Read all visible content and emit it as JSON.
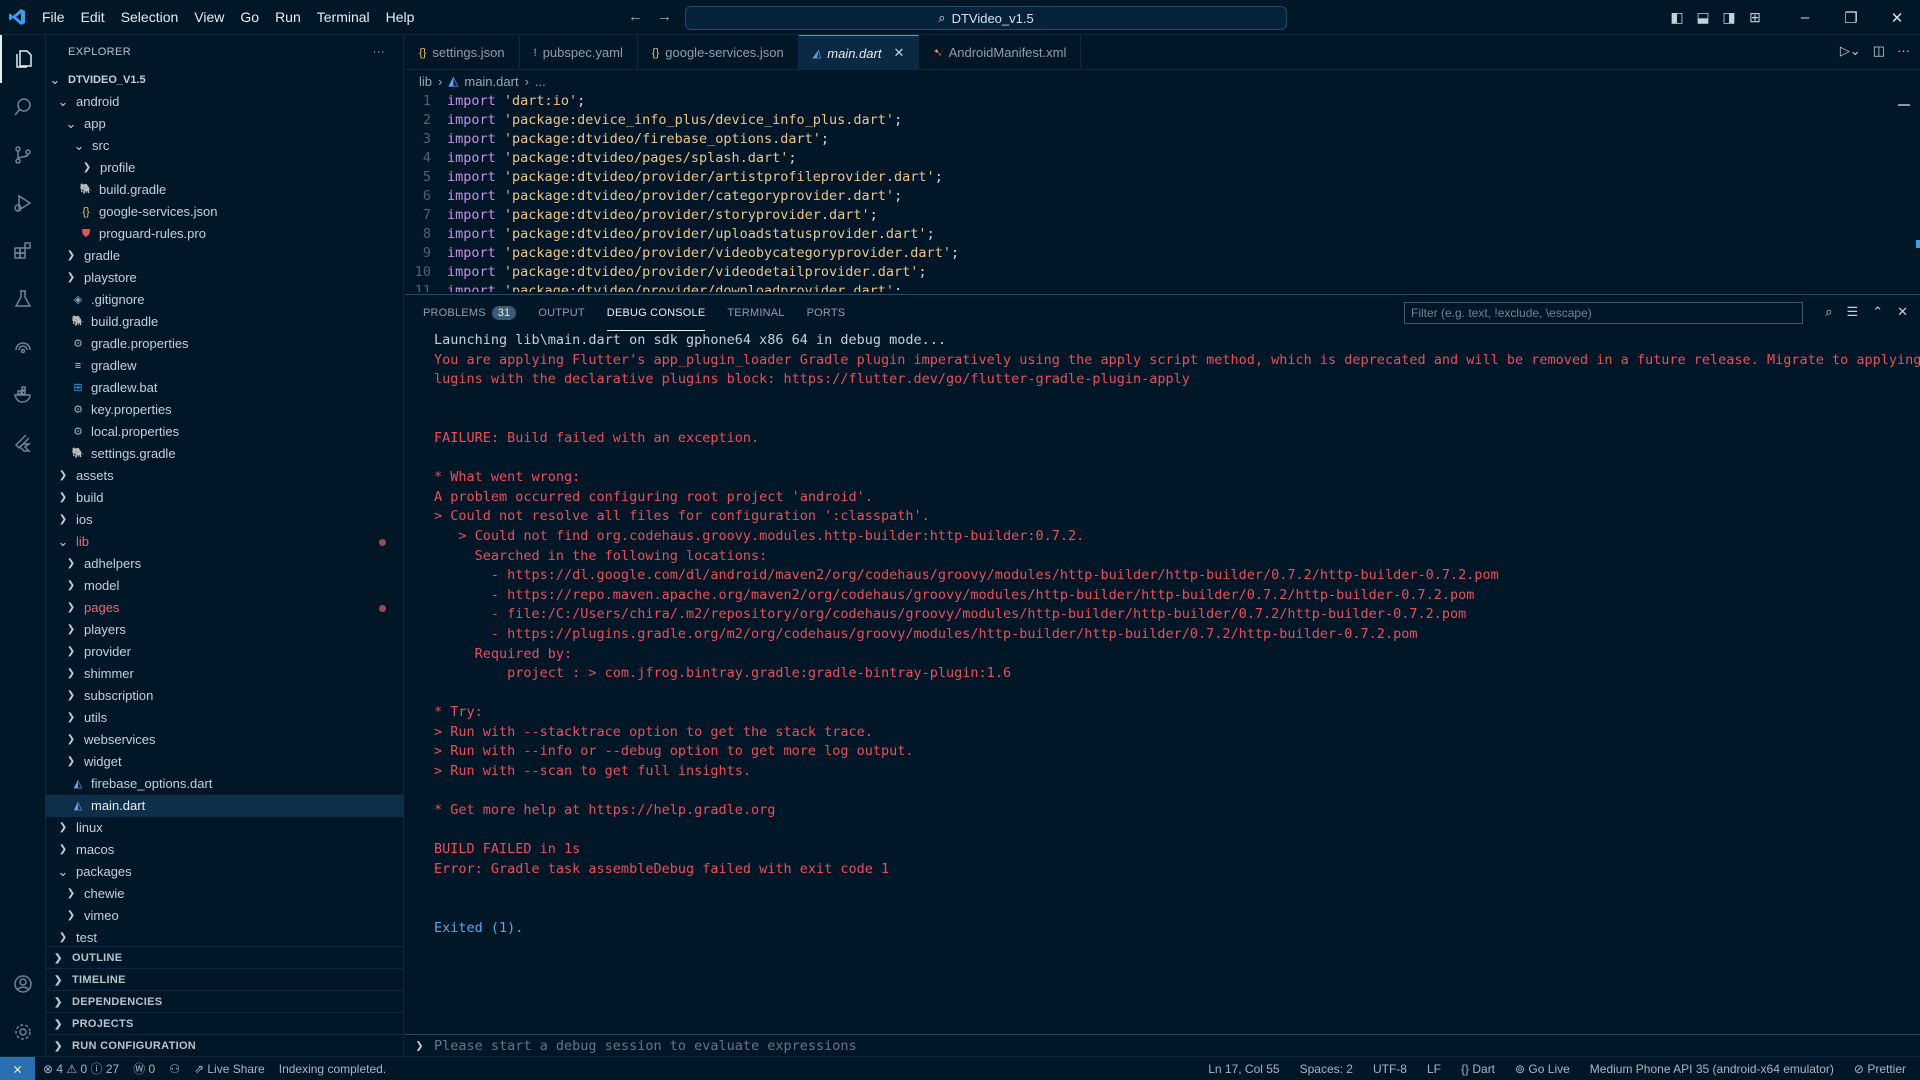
{
  "titlebar": {
    "menus": [
      "File",
      "Edit",
      "Selection",
      "View",
      "Go",
      "Run",
      "Terminal",
      "Help"
    ],
    "search_text": "DTVideo_v1.5"
  },
  "sidebar": {
    "title": "EXPLORER",
    "tree": [
      {
        "label": "DTVIDEO_V1.5",
        "depth": 0,
        "chev": "down",
        "bold": true
      },
      {
        "label": "android",
        "depth": 1,
        "chev": "down"
      },
      {
        "label": "app",
        "depth": 2,
        "chev": "down"
      },
      {
        "label": "src",
        "depth": 3,
        "chev": "down"
      },
      {
        "label": "profile",
        "depth": 4,
        "chev": "right"
      },
      {
        "label": "build.gradle",
        "depth": 3,
        "icon": "gradle"
      },
      {
        "label": "google-services.json",
        "depth": 3,
        "icon": "json"
      },
      {
        "label": "proguard-rules.pro",
        "depth": 3,
        "icon": "pro"
      },
      {
        "label": "gradle",
        "depth": 2,
        "chev": "right"
      },
      {
        "label": "playstore",
        "depth": 2,
        "chev": "right"
      },
      {
        "label": ".gitignore",
        "depth": 2,
        "icon": "git"
      },
      {
        "label": "build.gradle",
        "depth": 2,
        "icon": "gradle"
      },
      {
        "label": "gradle.properties",
        "depth": 2,
        "icon": "gear"
      },
      {
        "label": "gradlew",
        "depth": 2,
        "icon": "lines"
      },
      {
        "label": "gradlew.bat",
        "depth": 2,
        "icon": "win"
      },
      {
        "label": "key.properties",
        "depth": 2,
        "icon": "gear"
      },
      {
        "label": "local.properties",
        "depth": 2,
        "icon": "gear"
      },
      {
        "label": "settings.gradle",
        "depth": 2,
        "icon": "gradle"
      },
      {
        "label": "assets",
        "depth": 1,
        "chev": "right"
      },
      {
        "label": "build",
        "depth": 1,
        "chev": "right"
      },
      {
        "label": "ios",
        "depth": 1,
        "chev": "right"
      },
      {
        "label": "lib",
        "depth": 1,
        "chev": "down",
        "red": true,
        "dot": true
      },
      {
        "label": "adhelpers",
        "depth": 2,
        "chev": "right"
      },
      {
        "label": "model",
        "depth": 2,
        "chev": "right"
      },
      {
        "label": "pages",
        "depth": 2,
        "chev": "right",
        "red": true,
        "dot": true
      },
      {
        "label": "players",
        "depth": 2,
        "chev": "right"
      },
      {
        "label": "provider",
        "depth": 2,
        "chev": "right"
      },
      {
        "label": "shimmer",
        "depth": 2,
        "chev": "right"
      },
      {
        "label": "subscription",
        "depth": 2,
        "chev": "right"
      },
      {
        "label": "utils",
        "depth": 2,
        "chev": "right"
      },
      {
        "label": "webservices",
        "depth": 2,
        "chev": "right"
      },
      {
        "label": "widget",
        "depth": 2,
        "chev": "right"
      },
      {
        "label": "firebase_options.dart",
        "depth": 2,
        "icon": "dart"
      },
      {
        "label": "main.dart",
        "depth": 2,
        "icon": "dart",
        "selected": true
      },
      {
        "label": "linux",
        "depth": 1,
        "chev": "right"
      },
      {
        "label": "macos",
        "depth": 1,
        "chev": "right"
      },
      {
        "label": "packages",
        "depth": 1,
        "chev": "down"
      },
      {
        "label": "chewie",
        "depth": 2,
        "chev": "right"
      },
      {
        "label": "vimeo",
        "depth": 2,
        "chev": "right"
      },
      {
        "label": "test",
        "depth": 1,
        "chev": "right"
      }
    ],
    "sections": [
      "OUTLINE",
      "TIMELINE",
      "DEPENDENCIES",
      "PROJECTS",
      "RUN CONFIGURATION"
    ]
  },
  "tabs": [
    {
      "label": "settings.json",
      "icon": "{}",
      "icon_color": "#e6c07b"
    },
    {
      "label": "pubspec.yaml",
      "icon": "!",
      "icon_color": "#c792ea"
    },
    {
      "label": "google-services.json",
      "icon": "{}",
      "icon_color": "#e6c07b"
    },
    {
      "label": "main.dart",
      "icon": "◭",
      "icon_color": "#5ca7f0",
      "active": true
    },
    {
      "label": "AndroidManifest.xml",
      "icon": "➷",
      "icon_color": "#e8805b"
    }
  ],
  "breadcrumb": {
    "folder": "lib",
    "file": "main.dart",
    "more": "..."
  },
  "code": [
    {
      "n": "1",
      "s": "'dart:io'"
    },
    {
      "n": "2",
      "s": "'package:device_info_plus/device_info_plus.dart'"
    },
    {
      "n": "3",
      "s": "'package:dtvideo/firebase_options.dart'"
    },
    {
      "n": "4",
      "s": "'package:dtvideo/pages/splash.dart'"
    },
    {
      "n": "5",
      "s": "'package:dtvideo/provider/artistprofileprovider.dart'"
    },
    {
      "n": "6",
      "s": "'package:dtvideo/provider/categoryprovider.dart'"
    },
    {
      "n": "7",
      "s": "'package:dtvideo/provider/storyprovider.dart'"
    },
    {
      "n": "8",
      "s": "'package:dtvideo/provider/uploadstatusprovider.dart'"
    },
    {
      "n": "9",
      "s": "'package:dtvideo/provider/videobycategoryprovider.dart'"
    },
    {
      "n": "10",
      "s": "'package:dtvideo/provider/videodetailprovider.dart'"
    },
    {
      "n": "11",
      "s": "'package:dtvideo/provider/downloadprovider.dart'"
    }
  ],
  "code_keyword": "import",
  "panel": {
    "tabs": [
      "PROBLEMS",
      "OUTPUT",
      "DEBUG CONSOLE",
      "TERMINAL",
      "PORTS"
    ],
    "problems_count": "31",
    "filter_placeholder": "Filter (e.g. text, !exclude, \\escape)",
    "eval_placeholder": "Please start a debug session to evaluate expressions",
    "console": [
      {
        "t": "Launching lib\\main.dart on sdk gphone64 x86 64 in debug mode...",
        "c": "plain"
      },
      {
        "t": "You are applying Flutter's app_plugin_loader Gradle plugin imperatively using the apply script method, which is deprecated and will be removed in a future release. Migrate to applying Gradle p",
        "c": "red"
      },
      {
        "t": "lugins with the declarative plugins block: https://flutter.dev/go/flutter-gradle-plugin-apply",
        "c": "red"
      },
      {
        "t": "",
        "c": "red"
      },
      {
        "t": "",
        "c": "red"
      },
      {
        "t": "FAILURE: Build failed with an exception.",
        "c": "red"
      },
      {
        "t": "",
        "c": "red"
      },
      {
        "t": "* What went wrong:",
        "c": "red"
      },
      {
        "t": "A problem occurred configuring root project 'android'.",
        "c": "red"
      },
      {
        "t": "> Could not resolve all files for configuration ':classpath'.",
        "c": "red"
      },
      {
        "t": "   > Could not find org.codehaus.groovy.modules.http-builder:http-builder:0.7.2.",
        "c": "red"
      },
      {
        "t": "     Searched in the following locations:",
        "c": "red"
      },
      {
        "t": "       - https://dl.google.com/dl/android/maven2/org/codehaus/groovy/modules/http-builder/http-builder/0.7.2/http-builder-0.7.2.pom",
        "c": "red"
      },
      {
        "t": "       - https://repo.maven.apache.org/maven2/org/codehaus/groovy/modules/http-builder/http-builder/0.7.2/http-builder-0.7.2.pom",
        "c": "red"
      },
      {
        "t": "       - file:/C:/Users/chira/.m2/repository/org/codehaus/groovy/modules/http-builder/http-builder/0.7.2/http-builder-0.7.2.pom",
        "c": "red"
      },
      {
        "t": "       - https://plugins.gradle.org/m2/org/codehaus/groovy/modules/http-builder/http-builder/0.7.2/http-builder-0.7.2.pom",
        "c": "red"
      },
      {
        "t": "     Required by:",
        "c": "red"
      },
      {
        "t": "         project : > com.jfrog.bintray.gradle:gradle-bintray-plugin:1.6",
        "c": "red"
      },
      {
        "t": "",
        "c": "red"
      },
      {
        "t": "* Try:",
        "c": "red"
      },
      {
        "t": "> Run with --stacktrace option to get the stack trace.",
        "c": "red"
      },
      {
        "t": "> Run with --info or --debug option to get more log output.",
        "c": "red"
      },
      {
        "t": "> Run with --scan to get full insights.",
        "c": "red"
      },
      {
        "t": "",
        "c": "red"
      },
      {
        "t": "* Get more help at https://help.gradle.org",
        "c": "red"
      },
      {
        "t": "",
        "c": "red"
      },
      {
        "t": "BUILD FAILED in 1s",
        "c": "red"
      },
      {
        "t": "Error: Gradle task assembleDebug failed with exit code 1",
        "c": "red"
      },
      {
        "t": "",
        "c": "red"
      },
      {
        "t": "",
        "c": "red"
      },
      {
        "t": "Exited (1).",
        "c": "blue"
      }
    ]
  },
  "statusbar": {
    "problems": "⊗ 4 ⚠ 0 ⓘ 27",
    "ports": "Ⓦ 0",
    "live_share": "Live Share",
    "indexing": "Indexing completed.",
    "position": "Ln 17, Col 55",
    "spaces": "Spaces: 2",
    "encoding": "UTF-8",
    "eol": "LF",
    "language": "{} Dart",
    "go_live": "Go Live",
    "device": "Medium Phone API 35 (android-x64 emulator)",
    "prettier": "Prettier"
  }
}
